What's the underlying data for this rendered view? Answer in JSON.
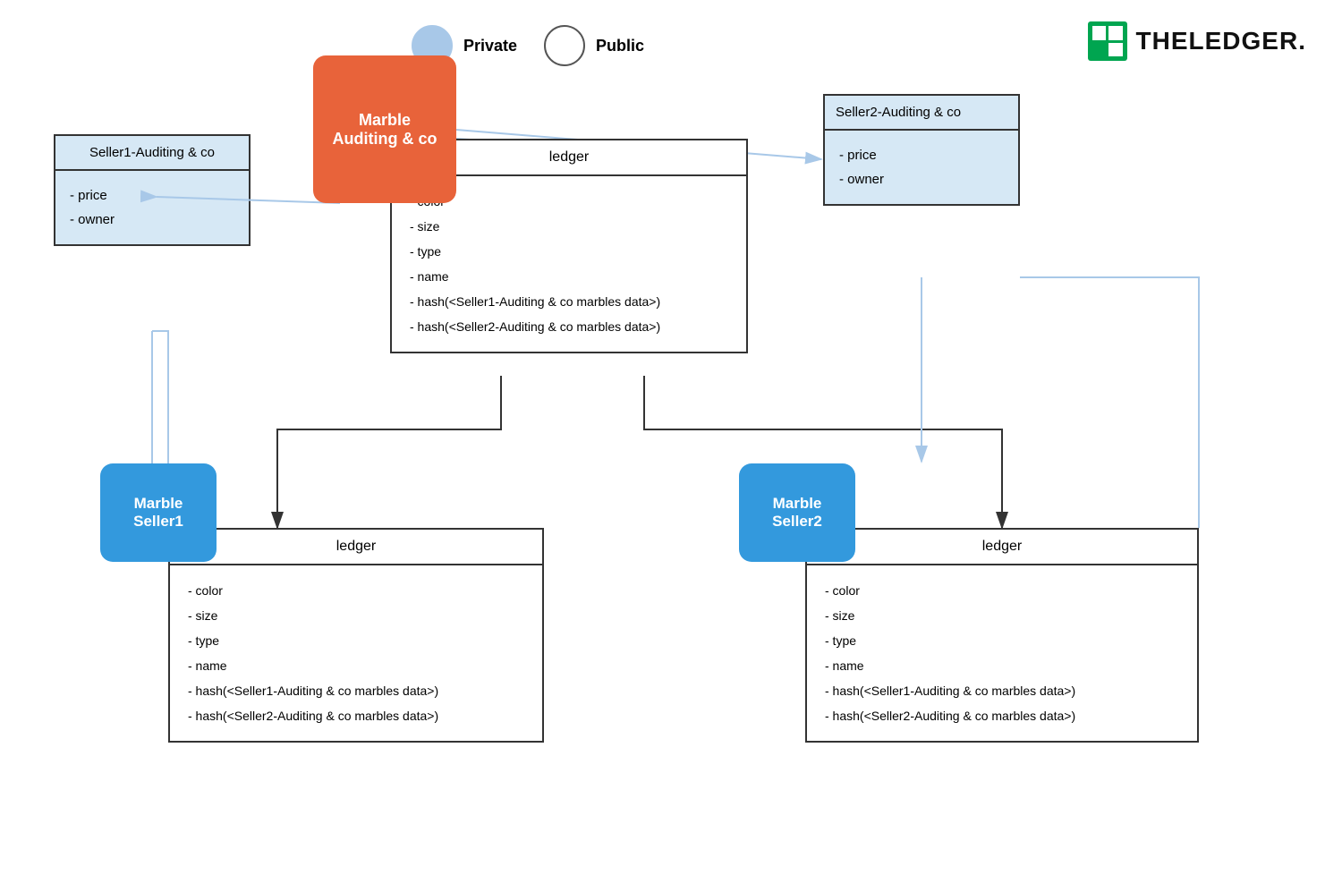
{
  "legend": {
    "private_label": "Private",
    "public_label": "Public"
  },
  "logo": {
    "text": "THELEDGER."
  },
  "marble_auditing": {
    "label": "Marble\nAuditing & co"
  },
  "seller1_auditing": {
    "header": "Seller1-Auditing & co",
    "fields": [
      "- price",
      "- owner"
    ]
  },
  "ledger_top": {
    "header": "ledger",
    "fields": [
      "- color",
      "- size",
      "- type",
      "- name",
      "- hash(<Seller1-Auditing & co marbles data>)",
      "- hash(<Seller2-Auditing & co marbles data>)"
    ]
  },
  "seller2_auditing": {
    "header": "Seller2-Auditing & co",
    "fields": [
      "- price",
      "- owner"
    ]
  },
  "marble_seller1": {
    "label": "Marble\nSeller1"
  },
  "ledger_bottom_left": {
    "header": "ledger",
    "fields": [
      "- color",
      "- size",
      "- type",
      "- name",
      "- hash(<Seller1-Auditing & co marbles data>)",
      "- hash(<Seller2-Auditing & co marbles data>)"
    ]
  },
  "marble_seller2": {
    "label": "Marble\nSeller2"
  },
  "ledger_bottom_right": {
    "header": "ledger",
    "fields": [
      "- color",
      "- size",
      "- type",
      "- name",
      "- hash(<Seller1-Auditing & co marbles data>)",
      "- hash(<Seller2-Auditing & co marbles data>)"
    ]
  }
}
